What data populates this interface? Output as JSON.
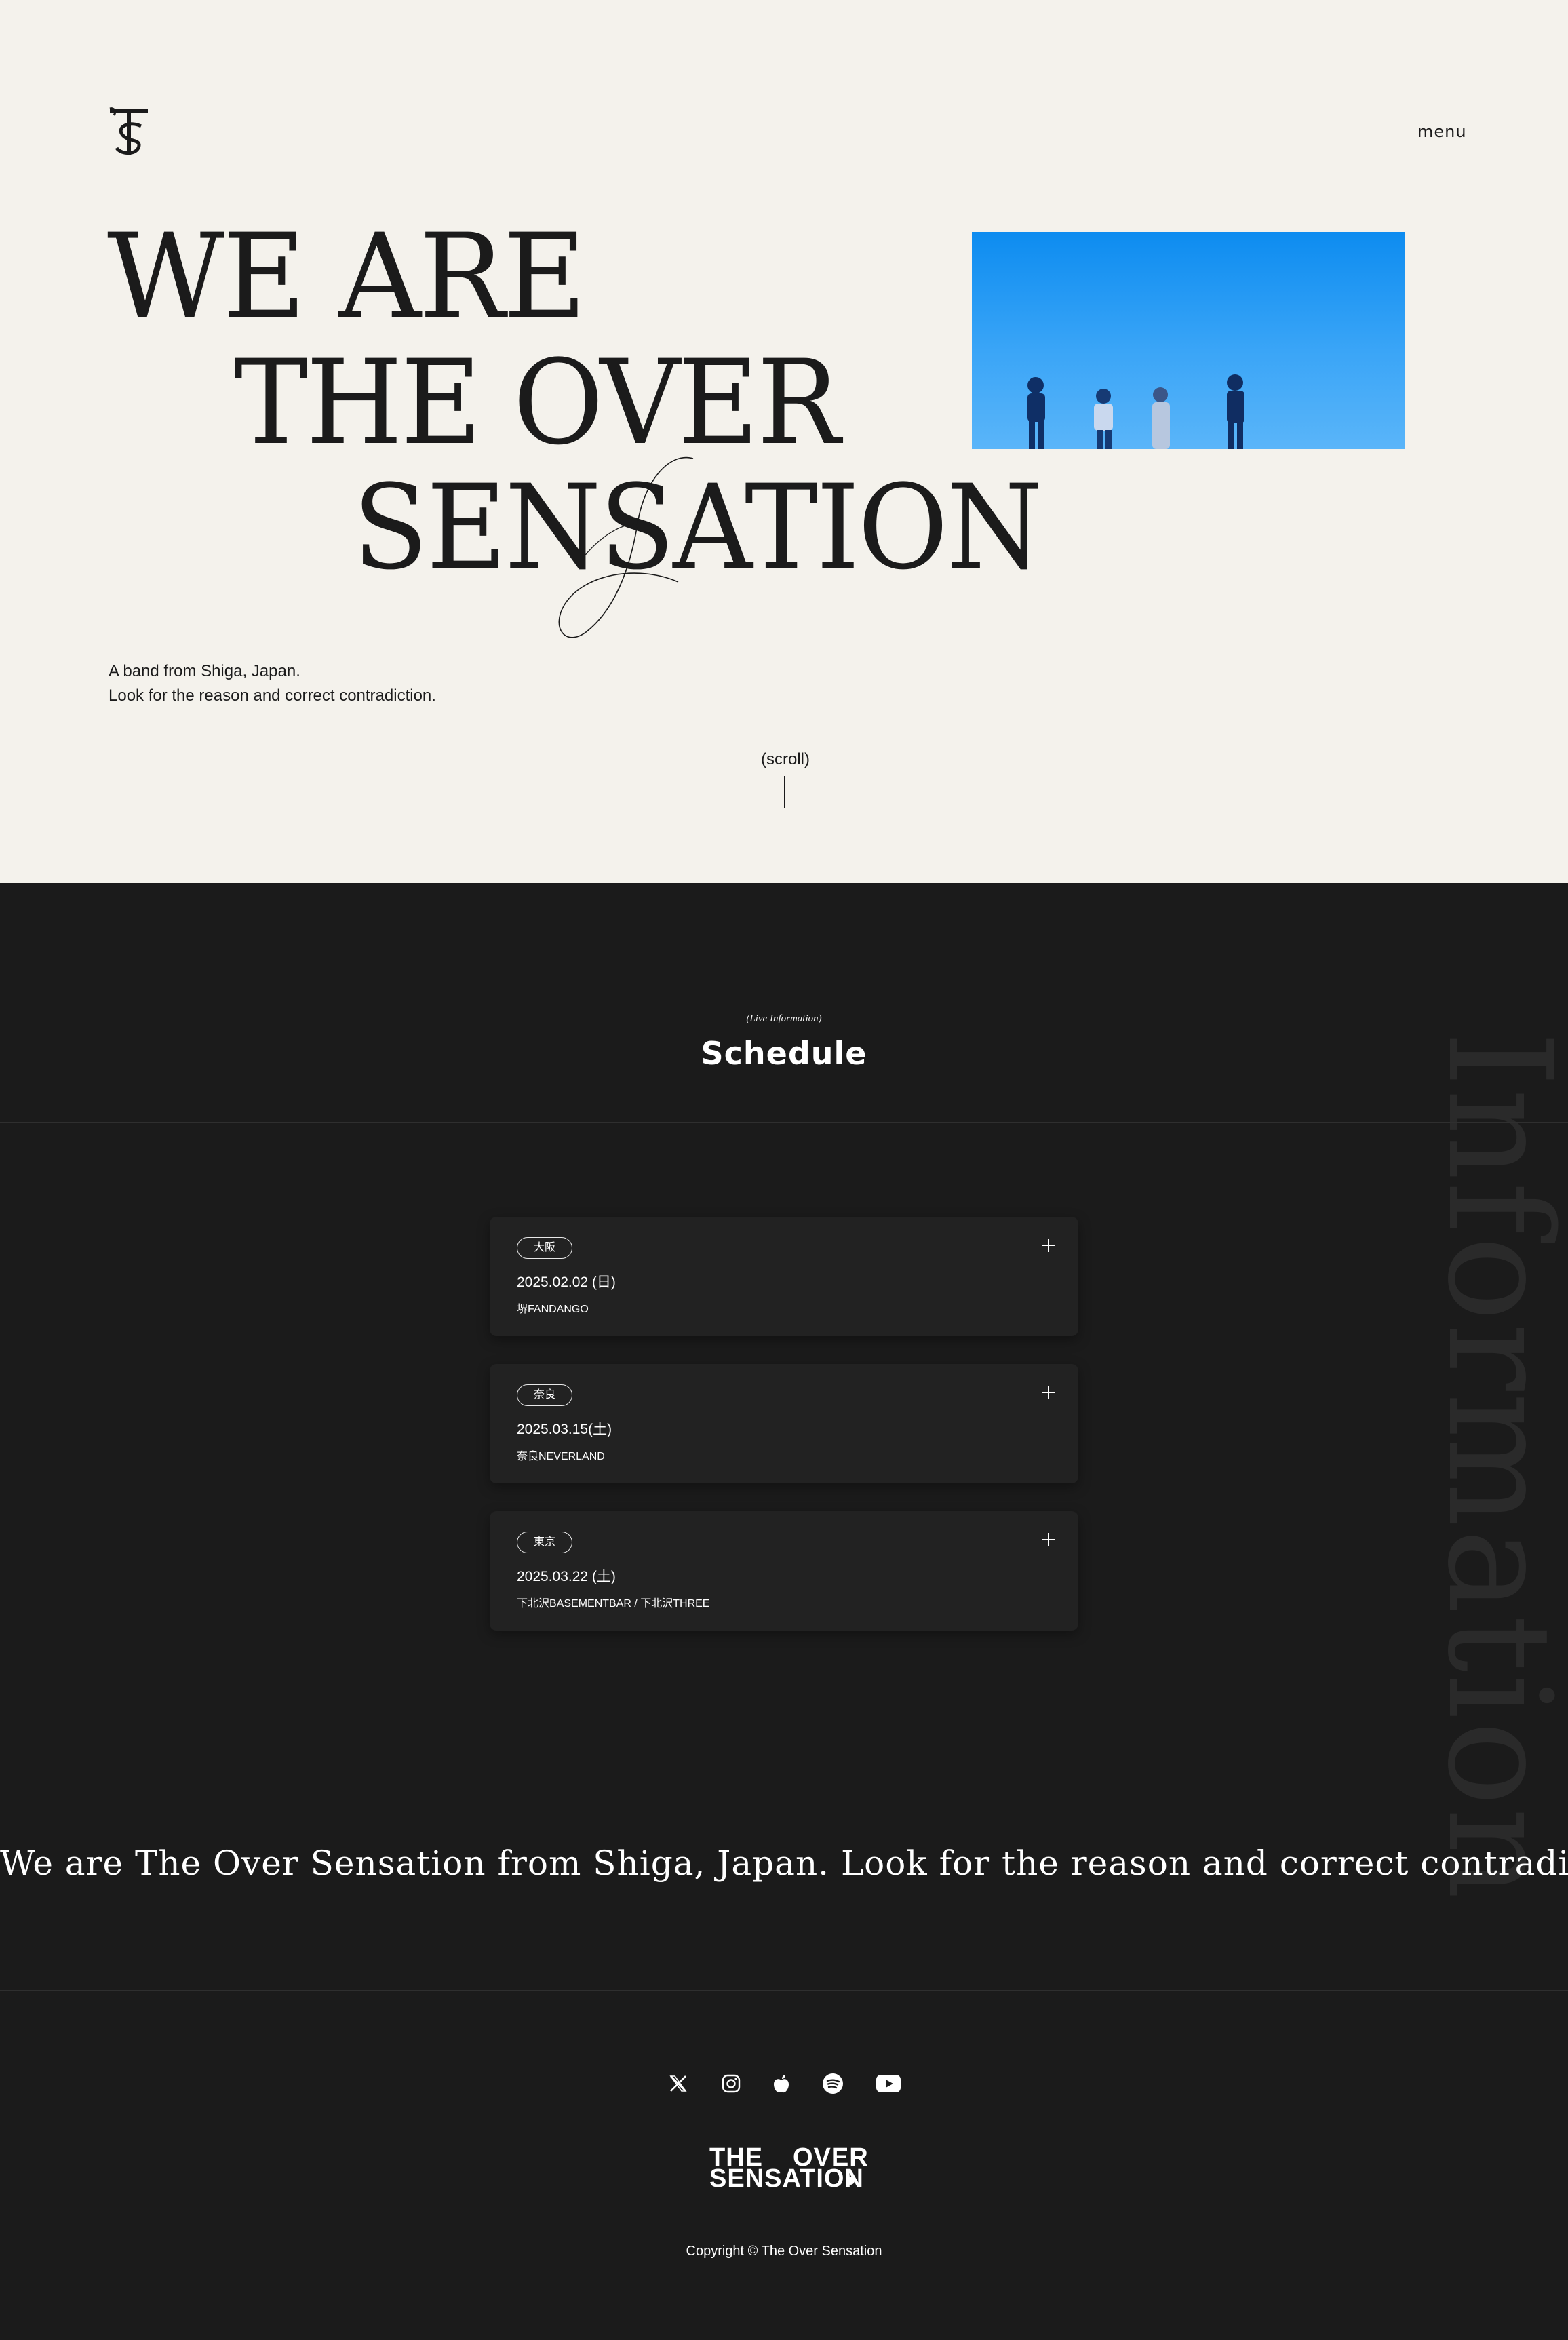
{
  "header": {
    "logo_icon": "tos-monogram-icon",
    "menu_label": "menu"
  },
  "hero": {
    "headline_line1": "WE ARE",
    "headline_line2": "THE OVER",
    "headline_line3": "SENSATION",
    "tagline_line1": "A band from Shiga, Japan.",
    "tagline_line2": "Look for the reason and correct contradiction.",
    "scroll_label": "(scroll)",
    "photo_sky_color": "#1a94f2"
  },
  "schedule": {
    "eyebrow": "(Live Information)",
    "title": "Schedule",
    "background_word": "Information",
    "events": [
      {
        "area": "大阪",
        "date": "2025.02.02 (日)",
        "venue": "堺FANDANGO"
      },
      {
        "area": "奈良",
        "date": "2025.03.15(土)",
        "venue": "奈良NEVERLAND"
      },
      {
        "area": "東京",
        "date": "2025.03.22 (土)",
        "venue": "下北沢BASEMENTBAR / 下北沢THREE"
      }
    ],
    "expand_icon": "plus-icon"
  },
  "marquee": {
    "text": "We are The Over Sensation from Shiga, Japan. Look for the reason and correct contradiction.  We are The Over Sensation from Shiga, Japan."
  },
  "footer": {
    "social_icons": [
      "x-icon",
      "instagram-icon",
      "apple-music-icon",
      "spotify-icon",
      "youtube-icon"
    ],
    "logo_line1_a": "THE",
    "logo_line1_b": "OVER",
    "logo_line2": "SENSATION",
    "copyright": "Copyright © The Over Sensation"
  },
  "colors": {
    "hero_bg": "#f4f2ec",
    "dark_bg": "#1b1b1b",
    "card_bg": "#222222",
    "ink": "#1b1b1b"
  }
}
